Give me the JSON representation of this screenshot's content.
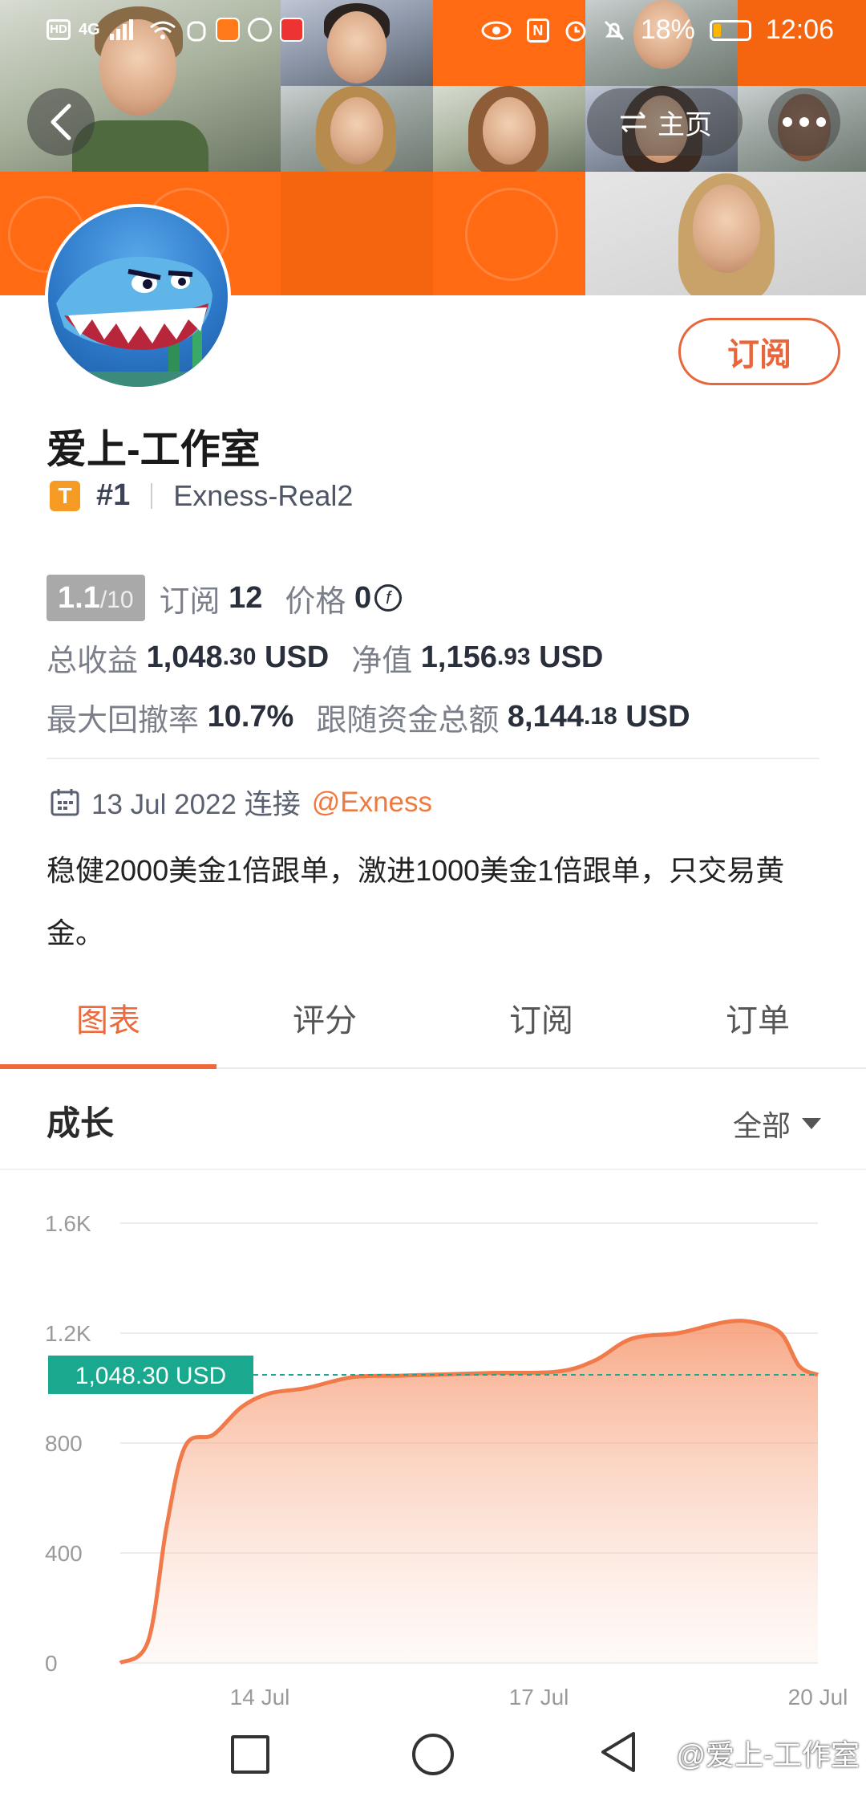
{
  "status_bar": {
    "left_indicators": [
      "HD",
      "4G"
    ],
    "battery": "18%",
    "time": "12:06"
  },
  "nav": {
    "home_label": "主页"
  },
  "profile": {
    "name": "爱上-工作室",
    "tier": "T",
    "rank": "#1",
    "account": "Exness-Real2",
    "subscribe_label": "订阅"
  },
  "stats": {
    "score": "1.1",
    "score_max": "/10",
    "subscriptions_label": "订阅",
    "subscriptions_value": "12",
    "price_label": "价格",
    "price_value": "0",
    "total_profit_label": "总收益",
    "total_profit_int": "1,048",
    "total_profit_dec": ".30",
    "total_profit_unit": "USD",
    "equity_label": "净值",
    "equity_int": "1,156",
    "equity_dec": ".93",
    "equity_unit": "USD",
    "max_drawdown_label": "最大回撤率",
    "max_drawdown_value": "10.7%",
    "follow_funds_label": "跟随资金总额",
    "follow_funds_int": "8,144",
    "follow_funds_dec": ".18",
    "follow_funds_unit": "USD"
  },
  "connection": {
    "date": "13 Jul 2022 连接",
    "broker": "@Exness"
  },
  "description": "稳健2000美金1倍跟单，激进1000美金1倍跟单，只交易黄金。",
  "tabs": [
    {
      "label": "图表",
      "active": true
    },
    {
      "label": "评分",
      "active": false
    },
    {
      "label": "订阅",
      "active": false
    },
    {
      "label": "订单",
      "active": false
    }
  ],
  "growth": {
    "title": "成长",
    "filter": "全部"
  },
  "chart_data": {
    "type": "area",
    "title": "",
    "xlabel": "",
    "ylabel": "",
    "ylim": [
      0,
      1600
    ],
    "yticks": [
      0,
      400,
      800,
      1200,
      1600
    ],
    "ytick_labels": [
      "0",
      "400",
      "800",
      "1.2K",
      "1.6K"
    ],
    "xticks": [
      "14 Jul",
      "17 Jul",
      "20 Jul"
    ],
    "xlim_days": [
      12.5,
      20
    ],
    "current_value_label": "1,048.30 USD",
    "current_value": 1048.3,
    "color": "#f07a4a",
    "series": [
      {
        "points": [
          {
            "x": "12.5 Jul",
            "y": 0
          },
          {
            "x": "12.8 Jul",
            "y": 80
          },
          {
            "x": "13.0 Jul",
            "y": 500
          },
          {
            "x": "13.2 Jul",
            "y": 790
          },
          {
            "x": "13.5 Jul",
            "y": 830
          },
          {
            "x": "13.8 Jul",
            "y": 930
          },
          {
            "x": "14.1 Jul",
            "y": 980
          },
          {
            "x": "14.5 Jul",
            "y": 1000
          },
          {
            "x": "15.0 Jul",
            "y": 1040
          },
          {
            "x": "15.5 Jul",
            "y": 1045
          },
          {
            "x": "16.0 Jul",
            "y": 1050
          },
          {
            "x": "16.5 Jul",
            "y": 1055
          },
          {
            "x": "17.2 Jul",
            "y": 1060
          },
          {
            "x": "17.6 Jul",
            "y": 1100
          },
          {
            "x": "18.0 Jul",
            "y": 1180
          },
          {
            "x": "18.5 Jul",
            "y": 1200
          },
          {
            "x": "19.0 Jul",
            "y": 1240
          },
          {
            "x": "19.3 Jul",
            "y": 1240
          },
          {
            "x": "19.6 Jul",
            "y": 1200
          },
          {
            "x": "19.8 Jul",
            "y": 1080
          },
          {
            "x": "20.0 Jul",
            "y": 1048.3
          }
        ]
      }
    ]
  },
  "watermark": "@爱上-工作室"
}
